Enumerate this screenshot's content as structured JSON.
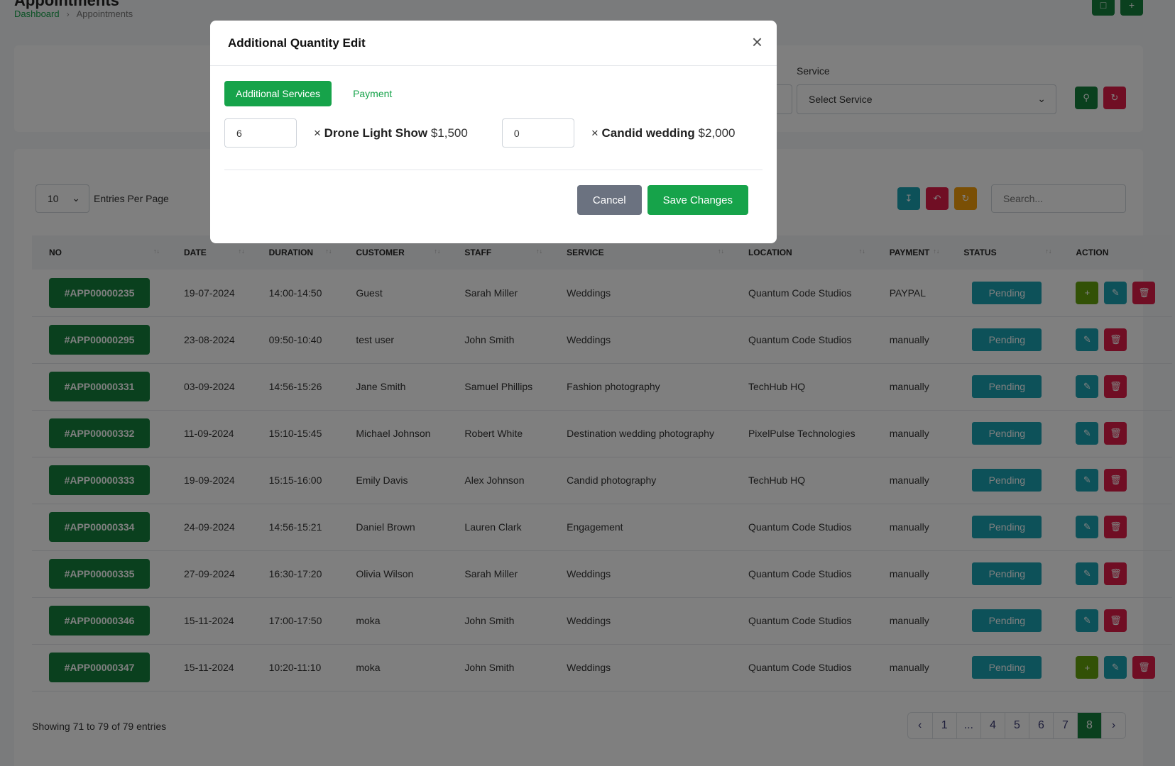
{
  "header": {
    "title_partial": "Appointments",
    "breadcrumb": [
      "Dashboard",
      "Appointments"
    ]
  },
  "filters": {
    "service_label": "Service",
    "service_value": "Select Service"
  },
  "table_controls": {
    "entries_value": "10",
    "entries_label": "Entries Per Page",
    "search_placeholder": "Search..."
  },
  "table": {
    "columns": [
      "NO",
      "DATE",
      "DURATION",
      "CUSTOMER",
      "STAFF",
      "SERVICE",
      "LOCATION",
      "PAYMENT",
      "STATUS",
      "ACTION"
    ],
    "rows": [
      {
        "id": "#APP00000235",
        "date": "19-07-2024",
        "duration": "14:00-14:50",
        "customer": "Guest",
        "staff": "Sarah Miller",
        "service": "Weddings",
        "location": "Quantum Code Studios",
        "payment": "PAYPAL",
        "status": "Pending"
      },
      {
        "id": "#APP00000295",
        "date": "23-08-2024",
        "duration": "09:50-10:40",
        "customer": "test user",
        "staff": "John Smith",
        "service": "Weddings",
        "location": "Quantum Code Studios",
        "payment": "manually",
        "status": "Pending"
      },
      {
        "id": "#APP00000331",
        "date": "03-09-2024",
        "duration": "14:56-15:26",
        "customer": "Jane Smith",
        "staff": "Samuel Phillips",
        "service": "Fashion photography",
        "location": "TechHub HQ",
        "payment": "manually",
        "status": "Pending"
      },
      {
        "id": "#APP00000332",
        "date": "11-09-2024",
        "duration": "15:10-15:45",
        "customer": "Michael Johnson",
        "staff": "Robert White",
        "service": "Destination wedding photography",
        "location": "PixelPulse Technologies",
        "payment": "manually",
        "status": "Pending"
      },
      {
        "id": "#APP00000333",
        "date": "19-09-2024",
        "duration": "15:15-16:00",
        "customer": "Emily Davis",
        "staff": "Alex Johnson",
        "service": "Candid photography",
        "location": "TechHub HQ",
        "payment": "manually",
        "status": "Pending"
      },
      {
        "id": "#APP00000334",
        "date": "24-09-2024",
        "duration": "14:56-15:21",
        "customer": "Daniel Brown",
        "staff": "Lauren Clark",
        "service": "Engagement",
        "location": "Quantum Code Studios",
        "payment": "manually",
        "status": "Pending"
      },
      {
        "id": "#APP00000335",
        "date": "27-09-2024",
        "duration": "16:30-17:20",
        "customer": "Olivia Wilson",
        "staff": "Sarah Miller",
        "service": "Weddings",
        "location": "Quantum Code Studios",
        "payment": "manually",
        "status": "Pending"
      },
      {
        "id": "#APP00000346",
        "date": "15-11-2024",
        "duration": "17:00-17:50",
        "customer": "moka",
        "staff": "John Smith",
        "service": "Weddings",
        "location": "Quantum Code Studios",
        "payment": "manually",
        "status": "Pending"
      },
      {
        "id": "#APP00000347",
        "date": "15-11-2024",
        "duration": "10:20-11:10",
        "customer": "moka",
        "staff": "John Smith",
        "service": "Weddings",
        "location": "Quantum Code Studios",
        "payment": "manually",
        "status": "Pending"
      }
    ],
    "rows_with_add": [
      0,
      8
    ]
  },
  "footer": {
    "showing": "Showing 71 to 79 of 79 entries",
    "pages": [
      "1",
      "...",
      "4",
      "5",
      "6",
      "7",
      "8"
    ],
    "active_page": "8"
  },
  "modal": {
    "title": "Additional Quantity Edit",
    "tabs": [
      "Additional Services",
      "Payment"
    ],
    "items": [
      {
        "qty": "6",
        "name": "Drone Light Show",
        "price": "$1,500"
      },
      {
        "qty": "0",
        "name": "Candid wedding",
        "price": "$2,000"
      }
    ],
    "cancel_label": "Cancel",
    "save_label": "Save Changes"
  },
  "colors": {
    "primary_green": "#15803d",
    "button_green": "#16a34a",
    "teal": "#1aa3b3",
    "danger": "#e11d48",
    "warning": "#f59e0b"
  }
}
